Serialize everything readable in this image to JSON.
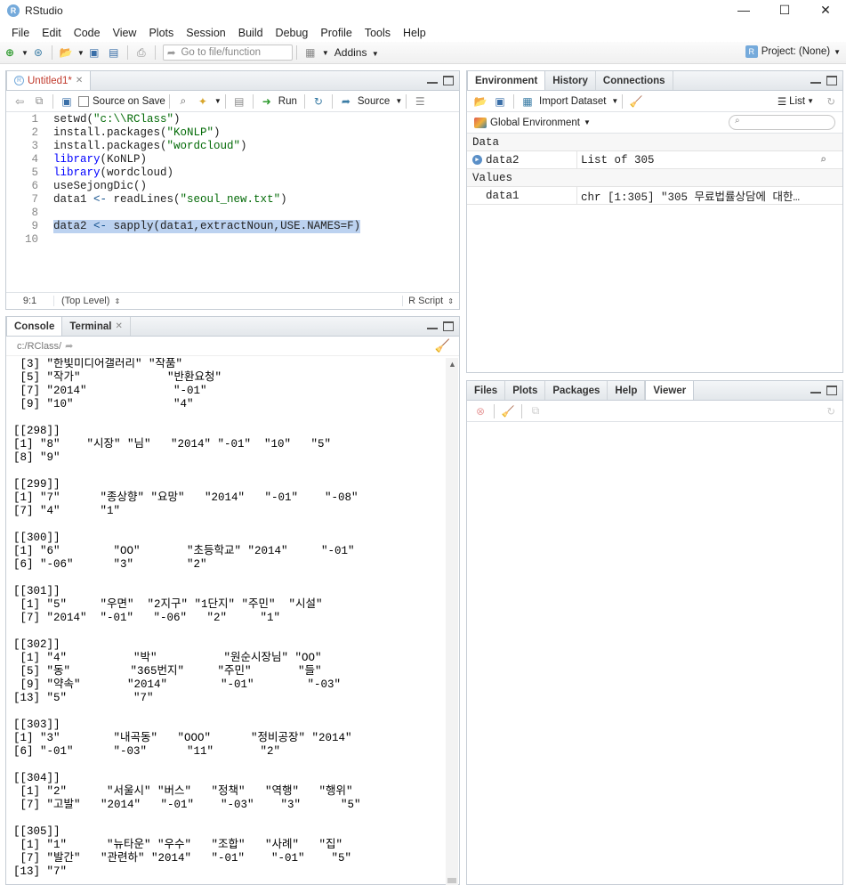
{
  "window": {
    "title": "RStudio",
    "minimize": "—",
    "maximize": "☐",
    "close": "✕"
  },
  "menu": [
    "File",
    "Edit",
    "Code",
    "View",
    "Plots",
    "Session",
    "Build",
    "Debug",
    "Profile",
    "Tools",
    "Help"
  ],
  "toolbar": {
    "goto_placeholder": "Go to file/function",
    "addins": "Addins",
    "project": "Project: (None)"
  },
  "editor": {
    "tab_label": "Untitled1*",
    "source_on_save": "Source on Save",
    "run": "Run",
    "source": "Source",
    "lines": [
      "setwd(\"c:\\\\RClass\")",
      "install.packages(\"KoNLP\")",
      "install.packages(\"wordcloud\")",
      "library(KoNLP)",
      "library(wordcloud)",
      "useSejongDic()",
      "data1 <- readLines(\"seoul_new.txt\")",
      "",
      "data2 <- sapply(data1,extractNoun,USE.NAMES=F)",
      ""
    ],
    "line_numbers": [
      "1",
      "2",
      "3",
      "4",
      "5",
      "6",
      "7",
      "8",
      "9",
      "10"
    ],
    "selected_line": 9,
    "cursor_pos": "9:1",
    "scope": "(Top Level)",
    "file_type": "R Script"
  },
  "console": {
    "tabs": [
      "Console",
      "Terminal"
    ],
    "path": "c:/RClass/",
    "output": [
      " [3] \"한빛미디어갤러리\" \"작품\"",
      " [5] \"작가\"             \"반환요청\"",
      " [7] \"2014\"             \"-01\"",
      " [9] \"10\"               \"4\"",
      "",
      "[[298]]",
      "[1] \"8\"    \"시장\" \"님\"   \"2014\" \"-01\"  \"10\"   \"5\"",
      "[8] \"9\"",
      "",
      "[[299]]",
      "[1] \"7\"      \"종상향\" \"요망\"   \"2014\"   \"-01\"    \"-08\"",
      "[7] \"4\"      \"1\"",
      "",
      "[[300]]",
      "[1] \"6\"        \"OO\"       \"초등학교\" \"2014\"     \"-01\"",
      "[6] \"-06\"      \"3\"        \"2\"",
      "",
      "[[301]]",
      " [1] \"5\"     \"우면\"  \"2지구\" \"1단지\" \"주민\"  \"시설\"",
      " [7] \"2014\"  \"-01\"   \"-06\"   \"2\"     \"1\"",
      "",
      "[[302]]",
      " [1] \"4\"          \"박\"          \"원순시장님\" \"OO\"",
      " [5] \"동\"         \"365번지\"     \"주민\"       \"들\"",
      " [9] \"약속\"       \"2014\"        \"-01\"        \"-03\"",
      "[13] \"5\"          \"7\"",
      "",
      "[[303]]",
      "[1] \"3\"        \"내곡동\"   \"OOO\"      \"정비공장\" \"2014\"",
      "[6] \"-01\"      \"-03\"      \"11\"       \"2\"",
      "",
      "[[304]]",
      " [1] \"2\"      \"서울시\" \"버스\"   \"정책\"   \"역행\"   \"행위\"",
      " [7] \"고발\"   \"2014\"   \"-01\"    \"-03\"    \"3\"      \"5\"",
      "",
      "[[305]]",
      " [1] \"1\"      \"뉴타운\" \"우수\"   \"조합\"   \"사례\"   \"집\"",
      " [7] \"발간\"   \"관련하\" \"2014\"   \"-01\"    \"-01\"    \"5\"",
      "[13] \"7\""
    ]
  },
  "environment": {
    "tabs": [
      "Environment",
      "History",
      "Connections"
    ],
    "import_dataset": "Import Dataset",
    "list_view": "List",
    "scope": "Global Environment",
    "sections": [
      {
        "title": "Data",
        "rows": [
          {
            "name": "data2",
            "value": "List of 305"
          }
        ]
      },
      {
        "title": "Values",
        "rows": [
          {
            "name": "data1",
            "value": "chr [1:305] \"305 무료법률상담에 대한…"
          }
        ]
      }
    ]
  },
  "files": {
    "tabs": [
      "Files",
      "Plots",
      "Packages",
      "Help",
      "Viewer"
    ],
    "active": "Viewer"
  }
}
